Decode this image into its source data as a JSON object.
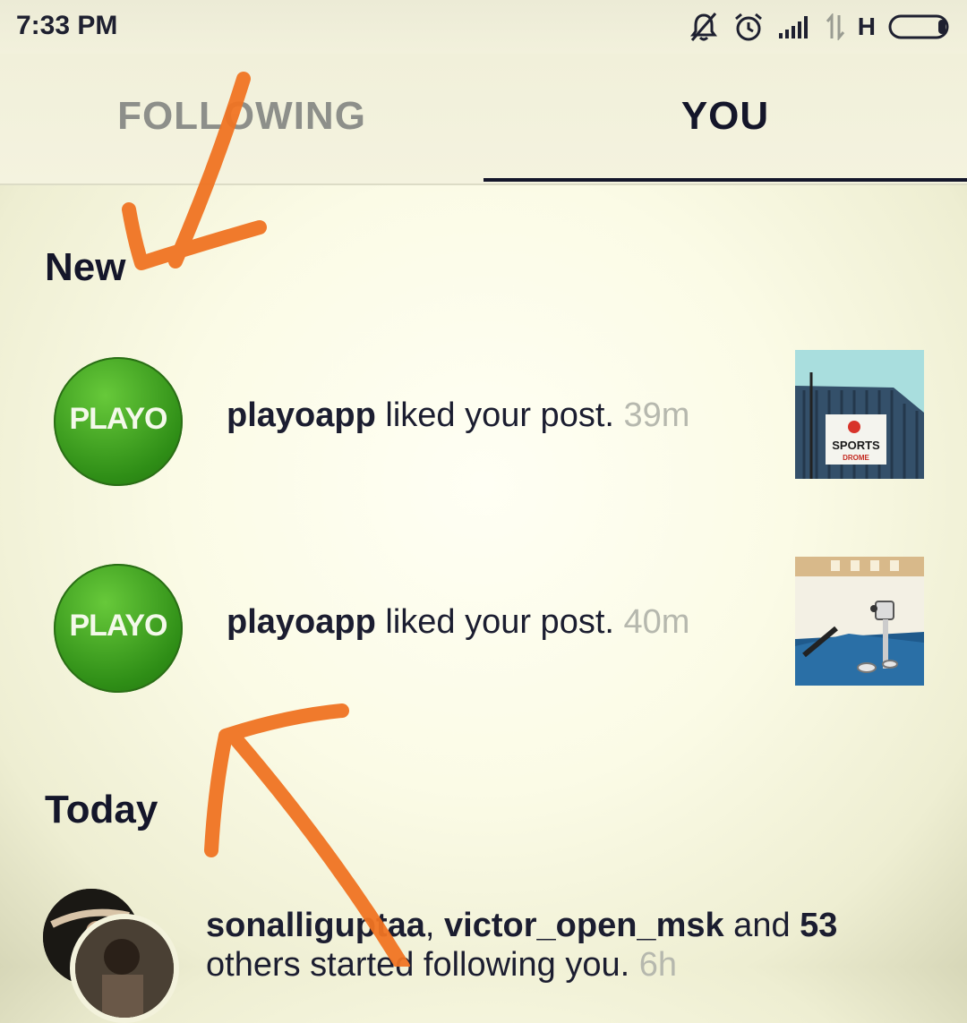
{
  "status_bar": {
    "time": "7:33 PM",
    "icons": [
      "bell-off-icon",
      "alarm-icon",
      "signal-icon",
      "data-arrows-icon",
      "battery-icon"
    ],
    "network": "H"
  },
  "tabs": [
    {
      "label": "FOLLOWING",
      "active": false
    },
    {
      "label": "YOU",
      "active": true
    }
  ],
  "sections": {
    "new": {
      "title": "New",
      "items": [
        {
          "user": "playoapp",
          "action": " liked your post.",
          "time": " 39m",
          "avatar_text": "PLAYO"
        },
        {
          "user": "playoapp",
          "action": " liked your post.",
          "time": " 40m",
          "avatar_text": "PLAYO"
        }
      ]
    },
    "today": {
      "title": "Today",
      "item": {
        "user1": "sonalliguptaa",
        "sep": ", ",
        "user2": "victor_open_msk",
        "and": " and ",
        "count": "53",
        "rest": " others started following you.",
        "time": " 6h"
      }
    }
  },
  "thumbnail_sign": {
    "line1": "SPORTS",
    "line2": "DROME"
  },
  "colors": {
    "accent_dark": "#14162a",
    "playo_green": "#3aa11e",
    "annotation_orange": "#f07423",
    "muted_text": "#b6b8ae"
  }
}
